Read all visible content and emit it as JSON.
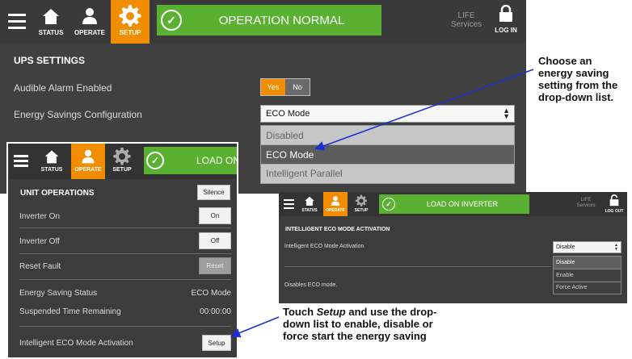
{
  "ups_panel": {
    "nav": {
      "status": "STATUS",
      "operate": "OPERATE",
      "setup": "SETUP"
    },
    "banner": "OPERATION NORMAL",
    "life": [
      "LIFE",
      "Services"
    ],
    "login": "LOG IN",
    "title": "UPS SETTINGS",
    "alarm_label": "Audible Alarm Enabled",
    "toggle": {
      "yes": "Yes",
      "no": "No"
    },
    "energy_label": "Energy Savings Configuration",
    "select_value": "ECO Mode",
    "options": [
      "Disabled",
      "ECO Mode",
      "Intelligent Parallel"
    ]
  },
  "unit_panel": {
    "nav": {
      "status": "STATUS",
      "operate": "OPERATE",
      "setup": "SETUP"
    },
    "banner": "LOAD ON",
    "title": "UNIT OPERATIONS",
    "silence": "Silence",
    "rows": {
      "inverter_on": "Inverter On",
      "inverter_on_btn": "On",
      "inverter_off": "Inverter Off",
      "inverter_off_btn": "Off",
      "reset_fault": "Reset Fault",
      "reset_btn": "Reset",
      "energy_status": "Energy Saving Status",
      "energy_status_value": "ECO Mode",
      "suspended": "Suspended Time Remaining",
      "suspended_value": "00:00:00",
      "ieco": "Intelligent ECO Mode Activation",
      "setup_btn": "Setup"
    }
  },
  "ieco_panel": {
    "nav": {
      "status": "STATUS",
      "operate": "OPERATE",
      "setup": "SETUP"
    },
    "banner": "LOAD ON INVERTER",
    "life": [
      "LIFE",
      "Services"
    ],
    "logout": "LOG OUT",
    "title": "INTELLIGENT ECO MODE ACTIVATION",
    "label": "Intelligent ECO Mode Activation",
    "select_value": "Disable",
    "options": [
      "Disable",
      "Enable",
      "Force Active"
    ],
    "description": "Disables ECO mode."
  },
  "callouts": {
    "top": "Choose an energy saving setting from the drop-down list.",
    "bottom_pre": "Touch ",
    "bottom_em": "Setup",
    "bottom_post": " and use the drop-down list to enable, disable or force start the energy saving"
  },
  "colors": {
    "accent": "#f28c00",
    "banner_green": "#5ab031",
    "panel": "#3f3f3f",
    "arrow": "#1a2fd6"
  }
}
